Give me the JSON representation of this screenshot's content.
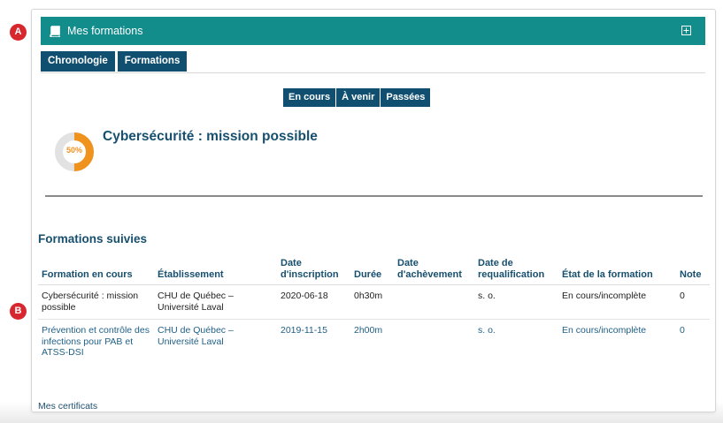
{
  "callouts": {
    "a": "A",
    "b": "B"
  },
  "header": {
    "title": "Mes formations",
    "icon": "book-icon",
    "expand_icon": "expand-icon",
    "bg_color": "#138c8c"
  },
  "tabs": [
    {
      "label": "Chronologie"
    },
    {
      "label": "Formations"
    }
  ],
  "filters": [
    {
      "label": "En cours"
    },
    {
      "label": "À venir"
    },
    {
      "label": "Passées"
    }
  ],
  "current_course": {
    "title": "Cybersécurité : mission possible",
    "progress_label": "50%",
    "progress": 0.5,
    "progress_color": "#f0921e"
  },
  "section_title": "Formations suivies",
  "table": {
    "headers": [
      "Formation en cours",
      "Établissement",
      "Date d'inscription",
      "Durée",
      "Date d'achèvement",
      "Date de requalification",
      "État de la formation",
      "Note"
    ],
    "rows": [
      [
        "Cybersécurité : mission possible",
        "CHU de Québec – Université Laval",
        "2020-06-18",
        "0h30m",
        "",
        "s. o.",
        "En cours/incomplète",
        "0"
      ],
      [
        "Prévention et contrôle des infections pour PAB et ATSS-DSI",
        "CHU de Québec – Université Laval",
        "2019-11-15",
        "2h00m",
        "",
        "s. o.",
        "En cours/incomplète",
        "0"
      ]
    ]
  },
  "certificates_link": "Mes certificats",
  "colors": {
    "primary": "#104f70",
    "heading": "#174f6e",
    "callout": "#d8262e"
  }
}
